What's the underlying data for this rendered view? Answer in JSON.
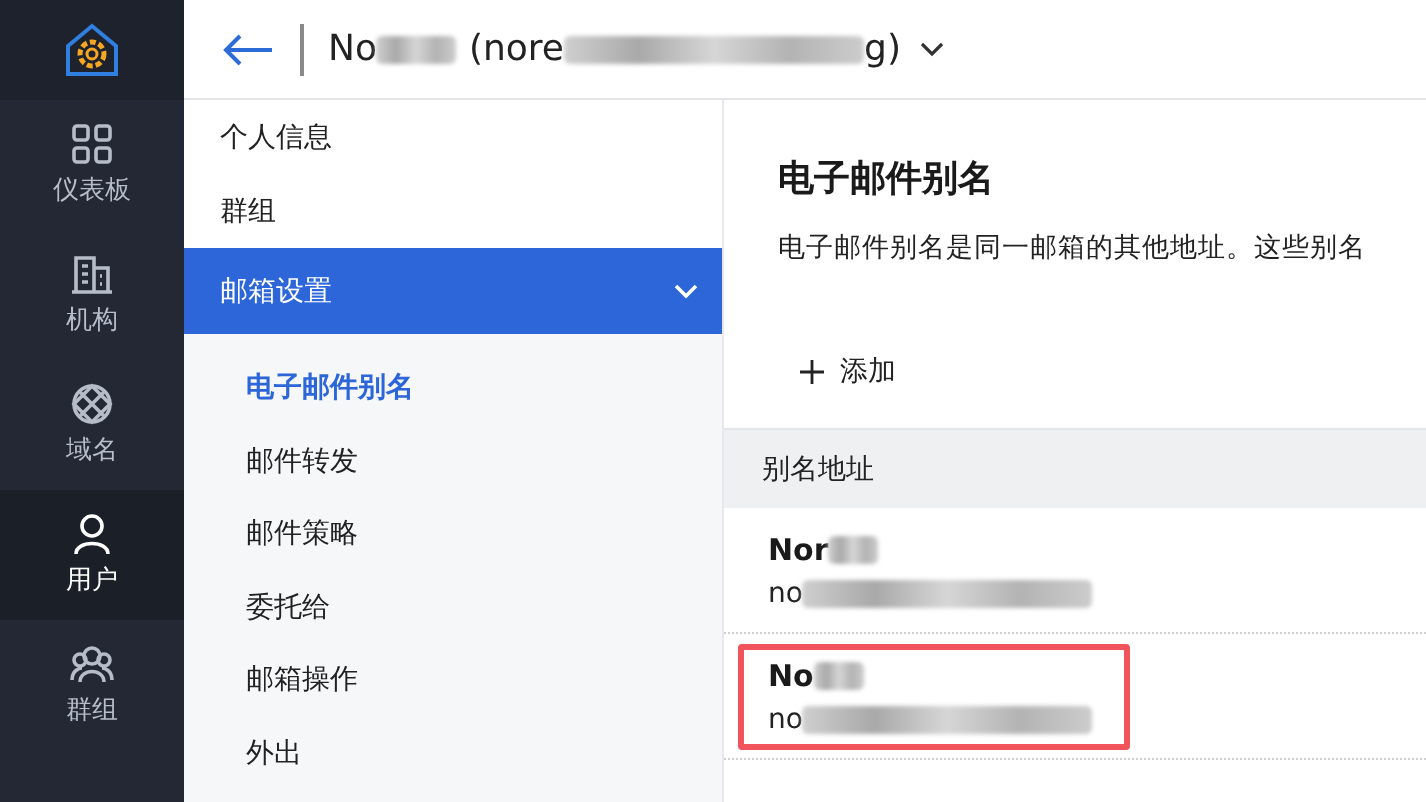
{
  "sidebar": {
    "items": [
      {
        "kind": "dashboard",
        "label": "仪表板",
        "selected": false
      },
      {
        "kind": "org",
        "label": "机构",
        "selected": false
      },
      {
        "kind": "domain",
        "label": "域名",
        "selected": false
      },
      {
        "kind": "user",
        "label": "用户",
        "selected": true
      },
      {
        "kind": "group",
        "label": "群组",
        "selected": false
      }
    ]
  },
  "header": {
    "name": "No",
    "address_start": "(nore",
    "address_end": "g)"
  },
  "menu": {
    "items": [
      {
        "label": "个人信息",
        "selected": false
      },
      {
        "label": "群组",
        "selected": false
      },
      {
        "label": "邮箱设置",
        "selected": true,
        "expanded": true,
        "children": [
          {
            "label": "电子邮件别名",
            "selected": true
          },
          {
            "label": "邮件转发",
            "selected": false
          },
          {
            "label": "邮件策略",
            "selected": false
          },
          {
            "label": "委托给",
            "selected": false
          },
          {
            "label": "邮箱操作",
            "selected": false
          },
          {
            "label": "外出",
            "selected": false
          }
        ]
      }
    ]
  },
  "content": {
    "title": "电子邮件别名",
    "description": "电子邮件别名是同一邮箱的其他地址。这些别名",
    "add_button": "添加",
    "table": {
      "columns": [
        "别名地址"
      ],
      "rows": [
        {
          "name": "Nor",
          "email": "no",
          "highlighted": false
        },
        {
          "name": "No",
          "email": "no",
          "highlighted": true
        }
      ]
    }
  }
}
